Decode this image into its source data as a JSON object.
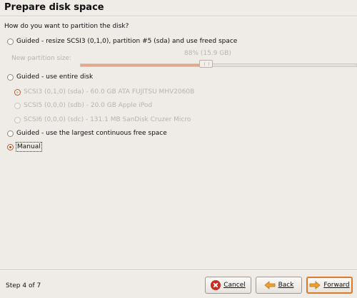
{
  "window": {
    "title": "Prepare disk space"
  },
  "question": "How do you want to partition the disk?",
  "options": {
    "resize": {
      "label": "Guided - resize SCSI3 (0,1,0), partition #5 (sda) and use freed space",
      "selected": false
    },
    "entire": {
      "label": "Guided - use entire disk",
      "selected": false
    },
    "largest": {
      "label": "Guided - use the largest continuous free space",
      "selected": false
    },
    "manual": {
      "label": "Manual",
      "selected": true
    }
  },
  "slider": {
    "label": "New partition size:",
    "value_text": "88% (15.9 GB)",
    "fraction": 0.88
  },
  "disks": [
    {
      "label": "SCSI3 (0,1,0) (sda) - 60.0 GB ATA FUJITSU MHV2060B",
      "selected": true
    },
    {
      "label": "SCSI5 (0,0,0) (sdb) - 20.0 GB Apple iPod",
      "selected": false
    },
    {
      "label": "SCSI6 (0,0,0) (sdc) - 131.1 MB SanDisk Cruzer Micro",
      "selected": false
    }
  ],
  "footer": {
    "step": "Step 4 of 7",
    "cancel_label": "Cancel",
    "back_label": "Back",
    "forward_label": "Forward"
  },
  "colors": {
    "background": "#efebe7",
    "accent": "#d97b2a",
    "cancel_icon": "#cc2a1e"
  },
  "icons": {
    "cancel": "cancel-icon",
    "back": "back-arrow-icon",
    "forward": "forward-arrow-icon"
  }
}
